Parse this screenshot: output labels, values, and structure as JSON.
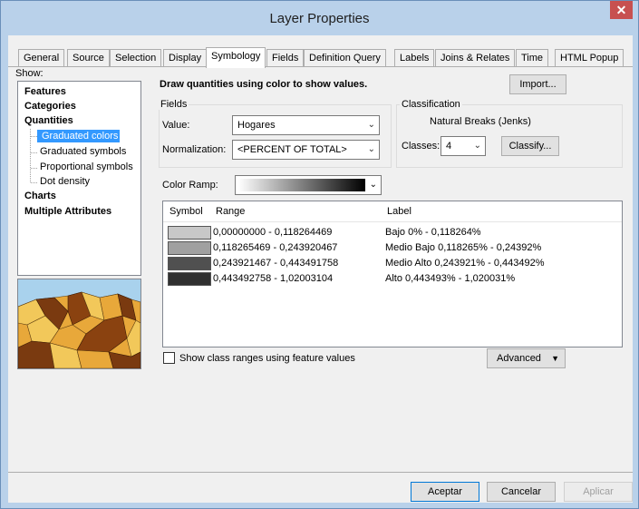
{
  "window": {
    "title": "Layer Properties"
  },
  "tabs": [
    {
      "label": "General"
    },
    {
      "label": "Source"
    },
    {
      "label": "Selection"
    },
    {
      "label": "Display"
    },
    {
      "label": "Symbology"
    },
    {
      "label": "Fields"
    },
    {
      "label": "Definition Query"
    },
    {
      "label": "Labels"
    },
    {
      "label": "Joins & Relates"
    },
    {
      "label": "Time"
    },
    {
      "label": "HTML Popup"
    }
  ],
  "active_tab": "Symbology",
  "show": {
    "label": "Show:",
    "features": "Features",
    "categories": "Categories",
    "quantities": "Quantities",
    "graduated_colors": "Graduated colors",
    "graduated_symbols": "Graduated symbols",
    "proportional_symbols": "Proportional symbols",
    "dot_density": "Dot density",
    "charts": "Charts",
    "multiple_attributes": "Multiple Attributes",
    "selected": "Graduated colors"
  },
  "heading": "Draw quantities using color to show values.",
  "import_button": "Import...",
  "fields": {
    "group_label": "Fields",
    "value_label": "Value:",
    "value": "Hogares",
    "normalization_label": "Normalization:",
    "normalization": "<PERCENT OF TOTAL>"
  },
  "classification": {
    "group_label": "Classification",
    "method": "Natural Breaks (Jenks)",
    "classes_label": "Classes:",
    "classes": "4",
    "classify_button": "Classify..."
  },
  "color_ramp": {
    "label": "Color Ramp:"
  },
  "table": {
    "col_symbol": "Symbol",
    "col_range": "Range",
    "col_label": "Label",
    "rows": [
      {
        "range": "0,00000000 - 0,118264469",
        "label": "Bajo 0% - 0,118264%",
        "color": "#c8c8c8"
      },
      {
        "range": "0,118265469 - 0,243920467",
        "label": "Medio Bajo 0,118265% - 0,24392%",
        "color": "#a0a0a0"
      },
      {
        "range": "0,243921467 - 0,443491758",
        "label": "Medio Alto 0,243921% - 0,443492%",
        "color": "#505050"
      },
      {
        "range": "0,443492758 - 1,02003104",
        "label": "Alto 0,443493% - 1,020031%",
        "color": "#303030"
      }
    ]
  },
  "show_class_ranges": "Show class ranges using feature values",
  "advanced_button": "Advanced",
  "buttons": {
    "ok": "Aceptar",
    "cancel": "Cancelar",
    "apply": "Aplicar"
  }
}
